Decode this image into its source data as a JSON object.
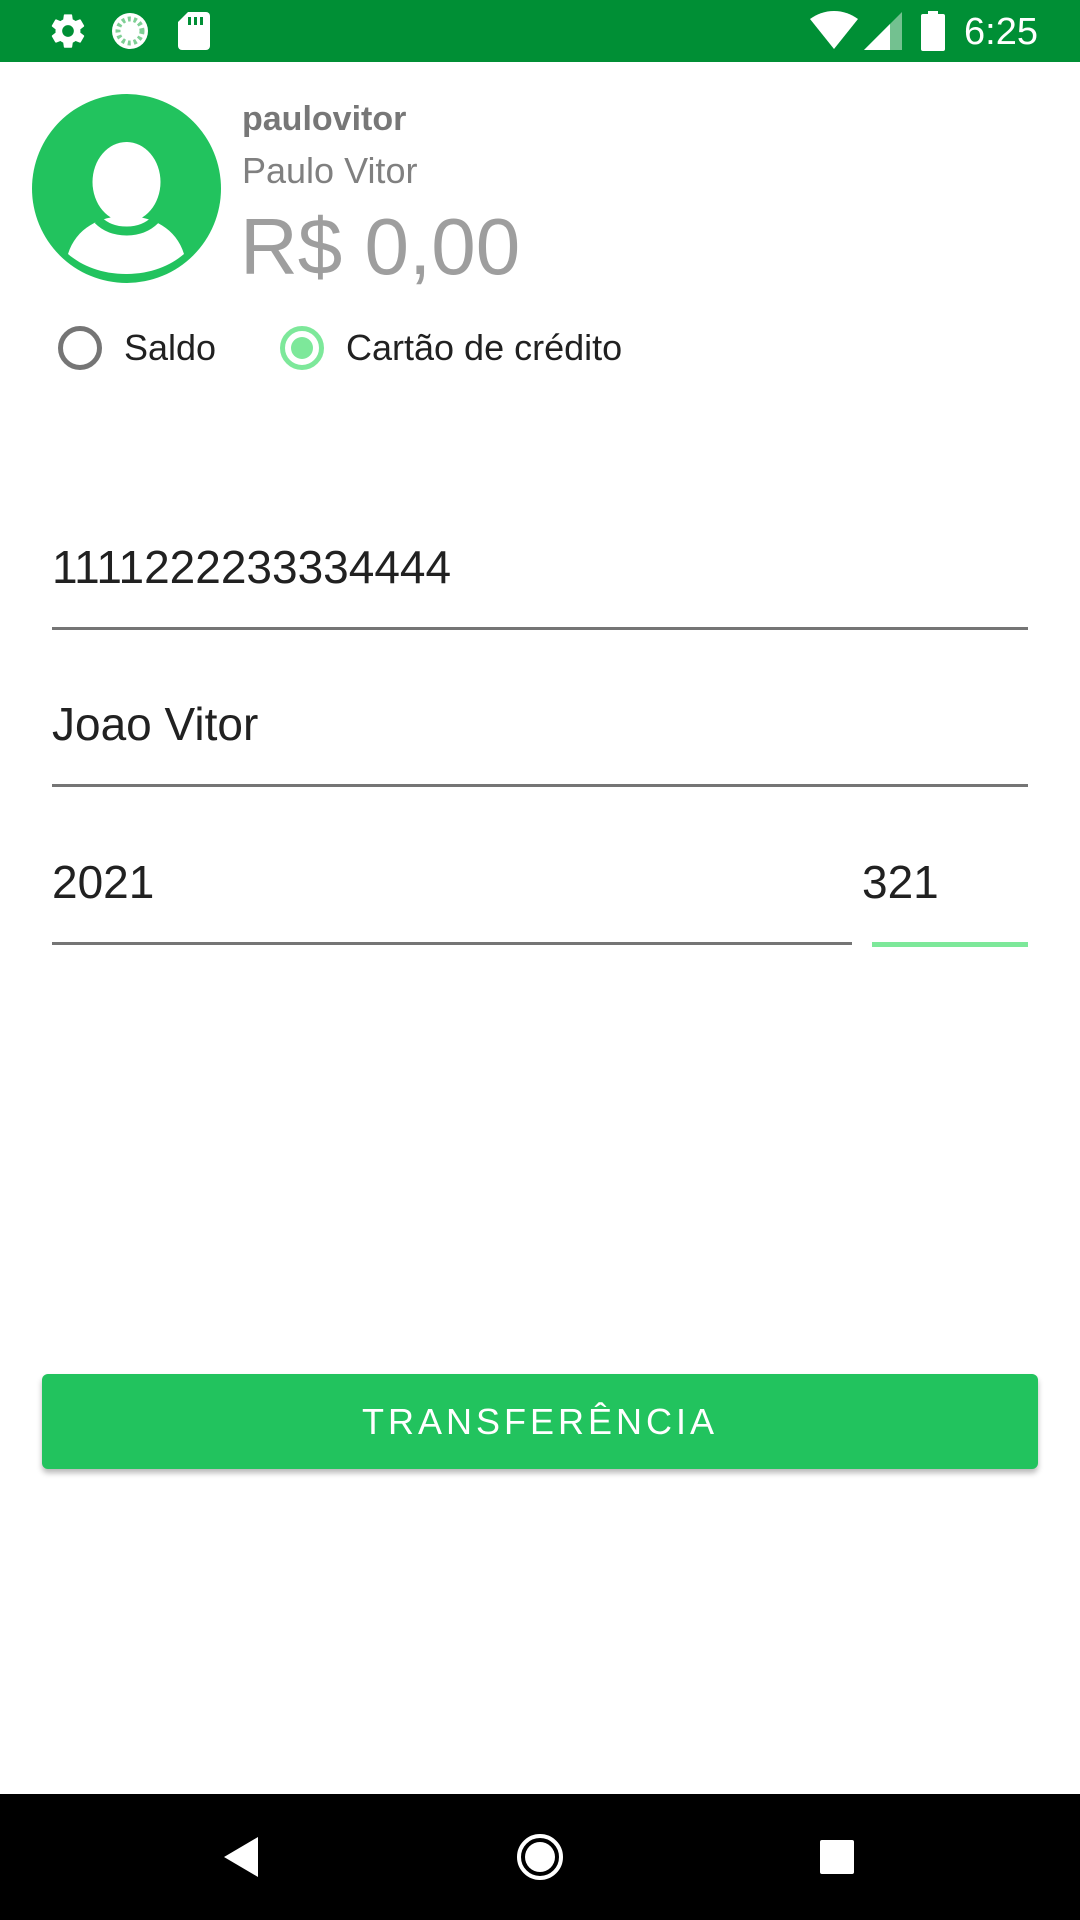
{
  "status_bar": {
    "time": "6:25",
    "icons": [
      "gear-icon",
      "sync-icon",
      "sd-card-icon",
      "wifi-icon",
      "signal-icon",
      "battery-icon"
    ],
    "background": "#008f35"
  },
  "profile": {
    "username": "paulovitor",
    "full_name": "Paulo Vitor",
    "balance": "R$ 0,00",
    "avatar_color": "#22c35e"
  },
  "payment_method": {
    "options": [
      {
        "label": "Saldo",
        "checked": false
      },
      {
        "label": "Cartão de crédito",
        "checked": true
      }
    ]
  },
  "card_form": {
    "card_number": "1111222233334444",
    "card_holder": "Joao Vitor",
    "expiry": "2021",
    "cvv": "321"
  },
  "actions": {
    "transfer_label": "TRANSFERÊNCIA",
    "accent": "#22c35e"
  },
  "nav_bar": {
    "buttons": [
      "back-icon",
      "home-icon",
      "recents-icon"
    ]
  }
}
